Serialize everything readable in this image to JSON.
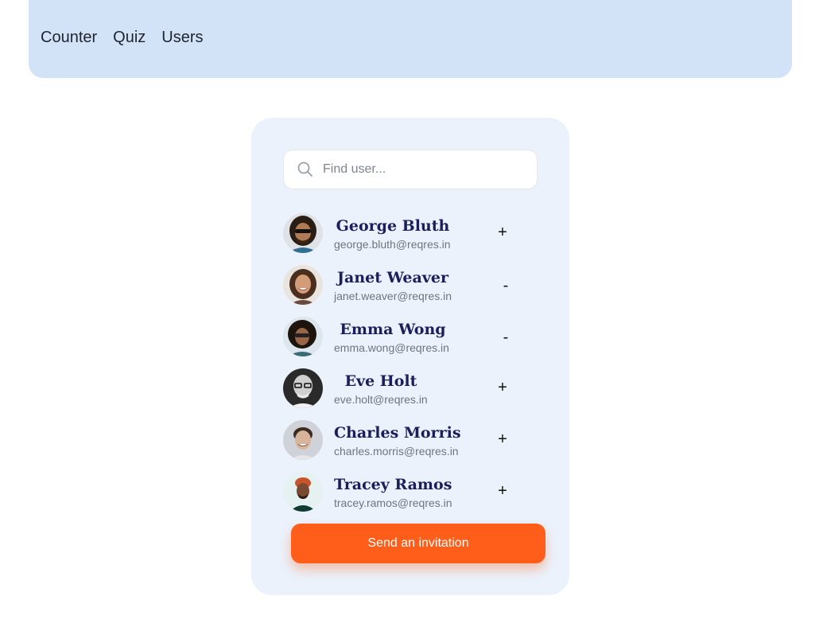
{
  "nav": {
    "links": [
      {
        "label": "Counter"
      },
      {
        "label": "Quiz"
      },
      {
        "label": "Users"
      }
    ]
  },
  "search": {
    "placeholder": "Find user...",
    "value": ""
  },
  "users": [
    {
      "name": "George Bluth",
      "email": "george.bluth@reqres.in",
      "action": "+",
      "invited": false
    },
    {
      "name": "Janet Weaver",
      "email": "janet.weaver@reqres.in",
      "action": "-",
      "invited": true
    },
    {
      "name": "Emma Wong",
      "email": "emma.wong@reqres.in",
      "action": "-",
      "invited": true
    },
    {
      "name": "Eve Holt",
      "email": "eve.holt@reqres.in",
      "action": "+",
      "invited": false
    },
    {
      "name": "Charles Morris",
      "email": "charles.morris@reqres.in",
      "action": "+",
      "invited": false
    },
    {
      "name": "Tracey Ramos",
      "email": "tracey.ramos@reqres.in",
      "action": "+",
      "invited": false
    }
  ],
  "send_button": {
    "label": "Send an invitation"
  },
  "colors": {
    "nav_bg": "#d2e3f7",
    "card_bg": "#ebf2fb",
    "name_text": "#1b1e5c",
    "accent": "#ff5e1a"
  }
}
